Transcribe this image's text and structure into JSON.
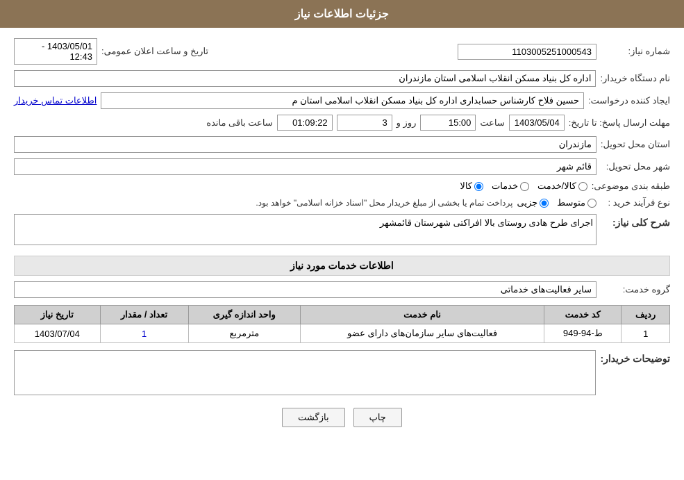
{
  "header": {
    "title": "جزئیات اطلاعات نیاز"
  },
  "fields": {
    "shomare_niaz_label": "شماره نیاز:",
    "shomare_niaz_value": "1103005251000543",
    "tarikh_label": "تاریخ و ساعت اعلان عمومی:",
    "tarikh_value": "1403/05/01 - 12:43",
    "nam_dastgah_label": "نام دستگاه خریدار:",
    "nam_dastgah_value": "اداره کل بنیاد مسکن انقلاب اسلامی استان مازندران",
    "ijad_konande_label": "ایجاد کننده درخواست:",
    "ijad_konande_value": "حسین فلاح کارشناس حسابداری اداره کل بنیاد مسکن انقلاب اسلامی استان م",
    "ijad_konande_link": "اطلاعات تماس خریدار",
    "mohlat_label": "مهلت ارسال پاسخ: تا تاریخ:",
    "mohlat_date": "1403/05/04",
    "mohlat_saat_label": "ساعت",
    "mohlat_saat_value": "15:00",
    "mohlat_rooz_label": "روز و",
    "mohlat_rooz_value": "3",
    "mohlat_baqi_label": "ساعت باقی مانده",
    "mohlat_baqi_value": "01:09:22",
    "ostan_label": "استان محل تحویل:",
    "ostan_value": "مازندران",
    "shahr_label": "شهر محل تحویل:",
    "shahr_value": "قائم شهر",
    "tabaqe_label": "طبقه بندی موضوعی:",
    "radio_kala": "کالا",
    "radio_khadamat": "خدمات",
    "radio_kala_khadamat": "کالا/خدمت",
    "nooe_farayand_label": "نوع فرآیند خرید :",
    "radio_jozii": "جزیی",
    "radio_motevaset": "متوسط",
    "nooe_farayand_note": "پرداخت تمام یا بخشی از مبلغ خریدار محل \"اسناد خزانه اسلامی\" خواهد بود.",
    "sharh_label": "شرح کلی نیاز:",
    "sharh_value": "اجرای طرح هادی روستای بالا افراکتی شهرستان قائمشهر",
    "khadamat_section": "اطلاعات خدمات مورد نیاز",
    "grouh_khadamat_label": "گروه خدمت:",
    "grouh_khadamat_value": "سایر فعالیت‌های خدماتی",
    "table": {
      "headers": [
        "ردیف",
        "کد خدمت",
        "نام خدمت",
        "واحد اندازه گیری",
        "تعداد / مقدار",
        "تاریخ نیاز"
      ],
      "rows": [
        {
          "radif": "1",
          "kod": "ط-94-949",
          "nam": "فعالیت‌های سایر سازمان‌های دارای عضو",
          "vahed": "مترمربع",
          "tedad": "1",
          "tarikh": "1403/07/04"
        }
      ]
    },
    "tozihat_label": "توضیحات خریدار:",
    "tozihat_value": ""
  },
  "buttons": {
    "chap": "چاپ",
    "bazgasht": "بازگشت"
  }
}
